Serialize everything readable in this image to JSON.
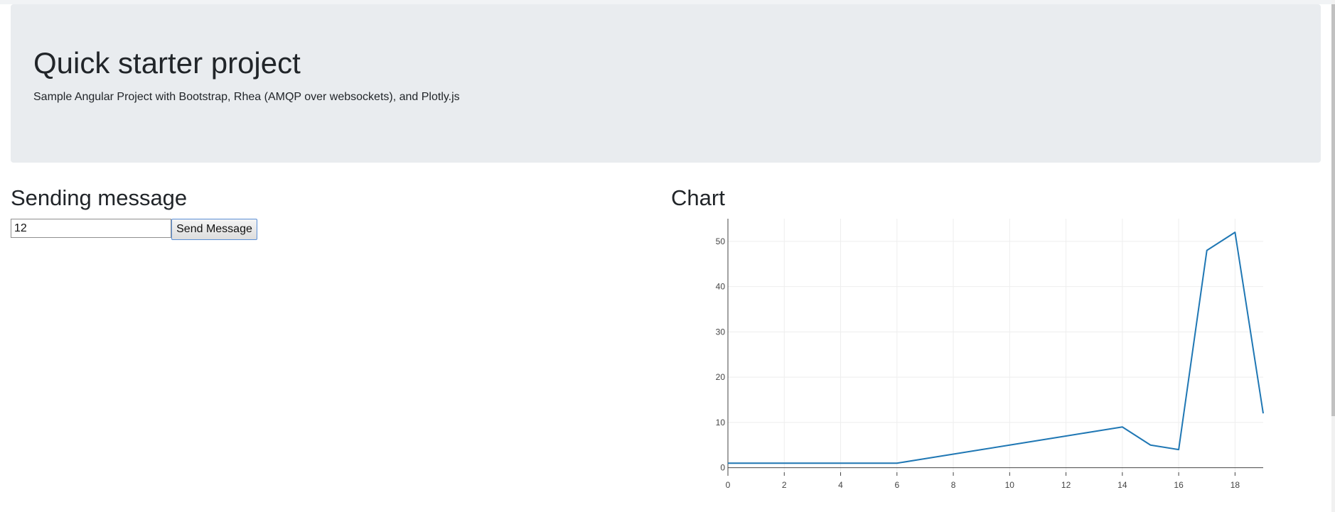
{
  "header": {
    "title": "Quick starter project",
    "subtitle": "Sample Angular Project with Bootstrap, Rhea (AMQP over websockets), and Plotly.js"
  },
  "sending": {
    "title": "Sending message",
    "input_value": "12",
    "button_label": "Send Message"
  },
  "chart_section": {
    "title": "Chart"
  },
  "chart_data": {
    "type": "line",
    "title": "",
    "xlabel": "",
    "ylabel": "",
    "x": [
      0,
      1,
      2,
      3,
      4,
      5,
      6,
      7,
      8,
      9,
      10,
      11,
      12,
      13,
      14,
      15,
      16,
      17,
      18,
      19
    ],
    "series": [
      {
        "values": [
          1,
          1,
          1,
          1,
          1,
          1,
          1,
          2,
          3,
          4,
          5,
          6,
          7,
          8,
          9,
          5,
          4,
          48,
          52,
          12
        ],
        "color": "#1f77b4"
      }
    ],
    "xlim": [
      0,
      19
    ],
    "ylim": [
      -1,
      55
    ],
    "x_ticks": [
      "0",
      "2",
      "4",
      "6",
      "8",
      "10",
      "12",
      "14",
      "16",
      "18"
    ],
    "y_ticks": [
      "0",
      "10",
      "20",
      "30",
      "40",
      "50"
    ],
    "grid": true
  }
}
